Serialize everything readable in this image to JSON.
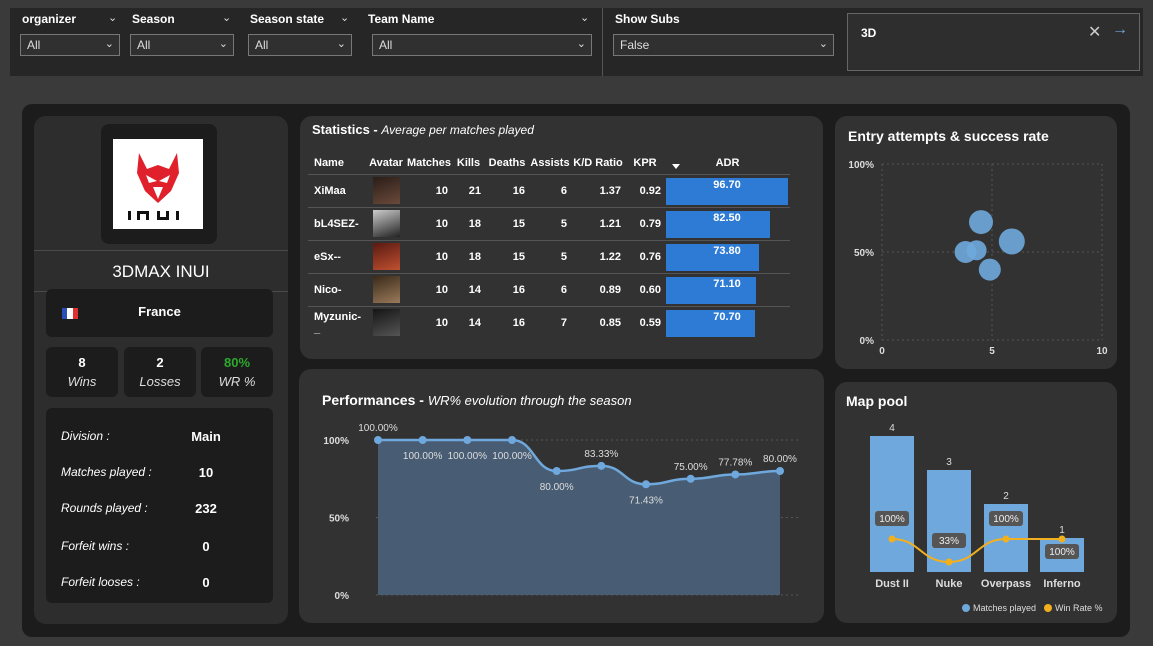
{
  "filters": [
    {
      "label": "organizer",
      "value": "All"
    },
    {
      "label": "Season",
      "value": "All"
    },
    {
      "label": "Season state",
      "value": "All"
    },
    {
      "label": "Team Name",
      "value": "All"
    },
    {
      "label": "Show Subs",
      "value": "False"
    }
  ],
  "search": {
    "value": "3D"
  },
  "team": {
    "name": "3DMAX INUI",
    "logo_text": "INUI",
    "country": "France",
    "wins": "8",
    "wins_label": "Wins",
    "losses": "2",
    "losses_label": "Losses",
    "wr": "80%",
    "wr_label": "WR %",
    "details": [
      {
        "label": "Division :",
        "value": "Main"
      },
      {
        "label": "Matches played :",
        "value": "10"
      },
      {
        "label": "Rounds played :",
        "value": "232"
      },
      {
        "label": "Forfeit wins :",
        "value": "0"
      },
      {
        "label": "Forfeit looses :",
        "value": "0"
      }
    ]
  },
  "statistics": {
    "title": "Statistics - ",
    "subtitle": "Average per matches played",
    "columns": [
      "Name",
      "Avatar",
      "Matches",
      "Kills",
      "Deaths",
      "Assists",
      "K/D Ratio",
      "KPR",
      "ADR"
    ],
    "rows": [
      {
        "name": "XiMaa",
        "matches": "10",
        "kills": "21",
        "deaths": "16",
        "assists": "6",
        "kd": "1.37",
        "kpr": "0.92",
        "adr": "96.70"
      },
      {
        "name": "bL4SEZ-",
        "matches": "10",
        "kills": "18",
        "deaths": "15",
        "assists": "5",
        "kd": "1.21",
        "kpr": "0.79",
        "adr": "82.50"
      },
      {
        "name": "eSx--",
        "matches": "10",
        "kills": "18",
        "deaths": "15",
        "assists": "5",
        "kd": "1.22",
        "kpr": "0.76",
        "adr": "73.80"
      },
      {
        "name": "Nico-",
        "matches": "10",
        "kills": "14",
        "deaths": "16",
        "assists": "6",
        "kd": "0.89",
        "kpr": "0.60",
        "adr": "71.10"
      },
      {
        "name": "Myzunic-_",
        "matches": "10",
        "kills": "14",
        "deaths": "16",
        "assists": "7",
        "kd": "0.85",
        "kpr": "0.59",
        "adr": "70.70"
      }
    ]
  },
  "performances": {
    "title": "Performances - ",
    "subtitle": "WR% evolution through the season"
  },
  "entry": {
    "title": "Entry attempts & success rate"
  },
  "mappool": {
    "title": "Map pool"
  },
  "chart_data": [
    {
      "type": "area",
      "title": "Performances - WR% evolution through the season",
      "x": [
        1,
        2,
        3,
        4,
        5,
        6,
        7,
        8,
        9,
        10
      ],
      "values": [
        100,
        100,
        100,
        100,
        80,
        83.33,
        71.43,
        75,
        77.78,
        80
      ],
      "labels": [
        "100.00%",
        "100.00%",
        "100.00%",
        "100.00%",
        "80.00%",
        "83.33%",
        "71.43%",
        "75.00%",
        "77.78%",
        "80.00%"
      ],
      "yticks": [
        "100%",
        "50%",
        "0%"
      ],
      "ylim": [
        0,
        100
      ],
      "color": "#6fa8dc"
    },
    {
      "type": "scatter",
      "title": "Entry attempts & success rate",
      "points": [
        [
          4.5,
          67
        ],
        [
          5.9,
          56
        ],
        [
          3.8,
          50
        ],
        [
          4.3,
          51
        ],
        [
          4.9,
          40
        ]
      ],
      "xticks": [
        "0",
        "5",
        "10"
      ],
      "yticks": [
        "100%",
        "50%",
        "0%"
      ],
      "xlim": [
        0,
        10
      ],
      "ylim": [
        0,
        100
      ],
      "color": "#6fa8dc"
    },
    {
      "type": "bar",
      "title": "Map pool",
      "categories": [
        "Dust II",
        "Nuke",
        "Overpass",
        "Inferno"
      ],
      "series": [
        {
          "name": "Matches played",
          "values": [
            4,
            3,
            2,
            1
          ],
          "labels": [
            "4",
            "3",
            "2",
            "1"
          ],
          "color": "#6fa8dc"
        },
        {
          "name": "Win Rate %",
          "values": [
            100,
            33,
            100,
            100
          ],
          "labels": [
            "100%",
            "33%",
            "100%",
            "100%"
          ],
          "color": "#f2b01e"
        }
      ],
      "legend": "bottom-right"
    }
  ]
}
